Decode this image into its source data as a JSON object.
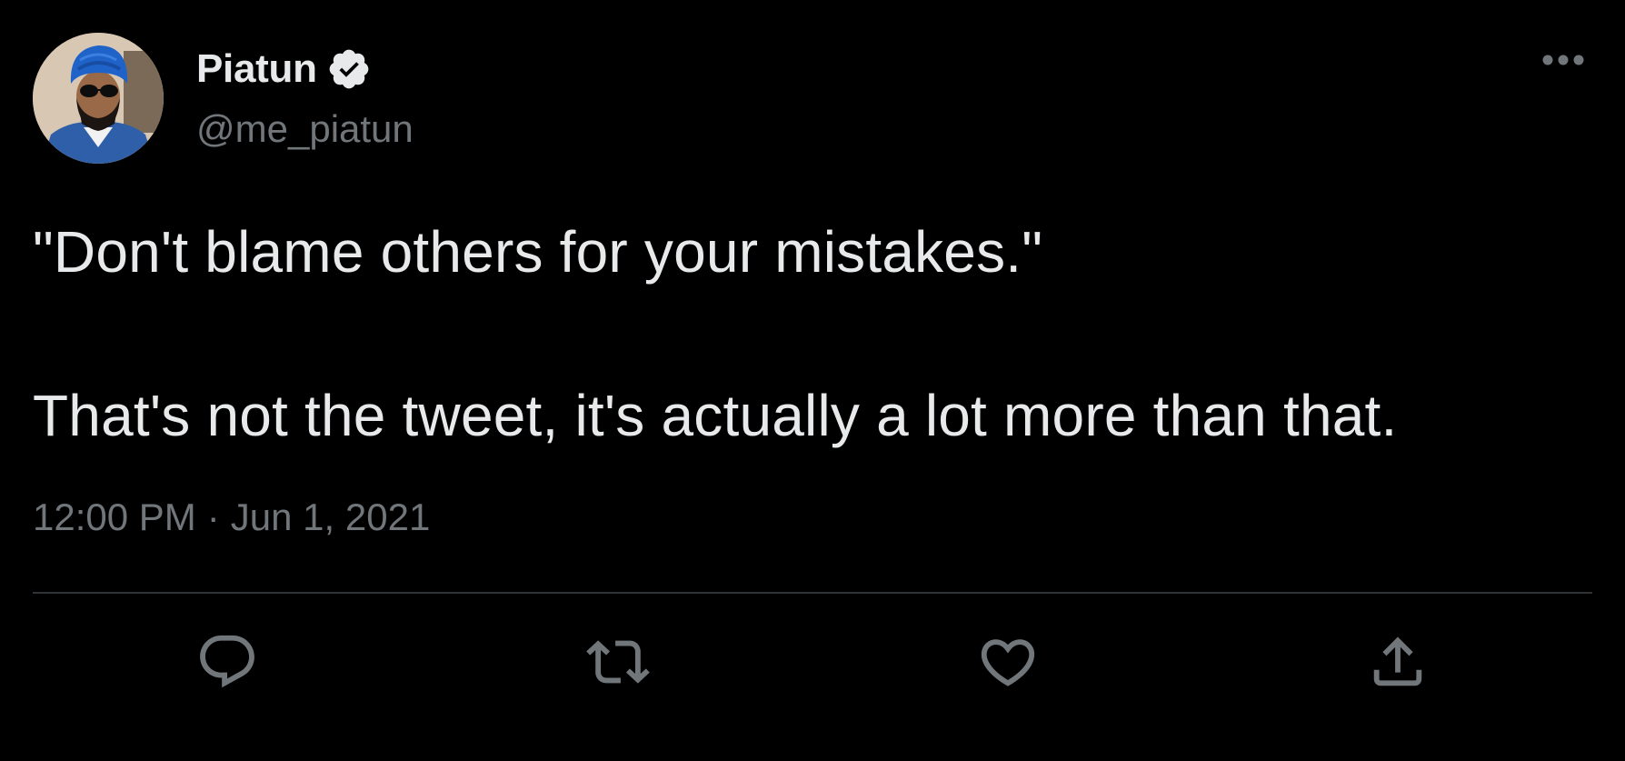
{
  "author": {
    "display_name": "Piatun",
    "handle": "@me_piatun",
    "verified": true,
    "avatar_icon": "profile-photo"
  },
  "tweet": {
    "lines": [
      "\"Don't blame others for your mistakes.\"",
      "That's not the tweet, it's actually a lot more than that."
    ]
  },
  "meta": {
    "time": "12:00 PM",
    "separator": "·",
    "date": "Jun 1, 2021"
  },
  "actions": [
    {
      "name": "reply",
      "icon": "reply-icon"
    },
    {
      "name": "retweet",
      "icon": "retweet-icon"
    },
    {
      "name": "like",
      "icon": "heart-icon"
    },
    {
      "name": "share",
      "icon": "share-icon"
    }
  ],
  "colors": {
    "background": "#000000",
    "primary_text": "#e7e9ea",
    "secondary_text": "#71767b",
    "divider": "#2f3336"
  }
}
